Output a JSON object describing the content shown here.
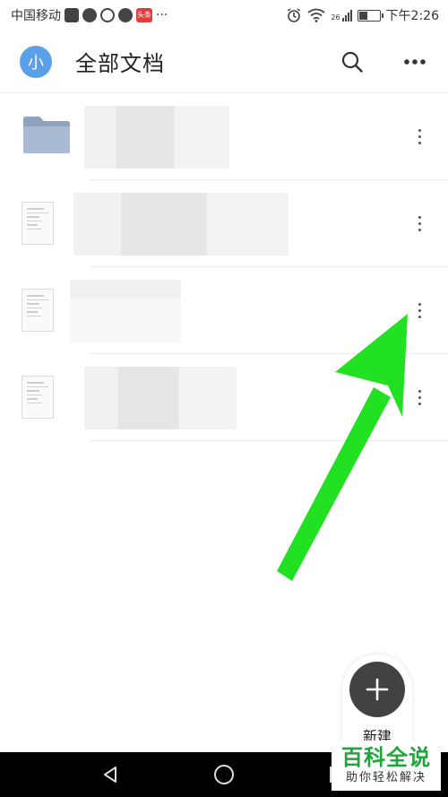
{
  "status_bar": {
    "carrier": "中国移动",
    "ellipsis": "···",
    "badge": "头条",
    "network": "26",
    "time": "下午2:26"
  },
  "header": {
    "avatar_text": "小",
    "title": "全部文档"
  },
  "documents": [
    {
      "icon": "folder-icon"
    },
    {
      "icon": "document-icon"
    },
    {
      "icon": "document-icon"
    },
    {
      "icon": "document-icon"
    }
  ],
  "fab": {
    "label": "新建"
  },
  "watermark": {
    "title": "百科全说",
    "subtitle": "助你轻松解决"
  },
  "colors": {
    "avatar": "#5aa0e8",
    "fab": "#424242",
    "arrow": "#22e022",
    "watermark_green": "#1fa53b"
  }
}
